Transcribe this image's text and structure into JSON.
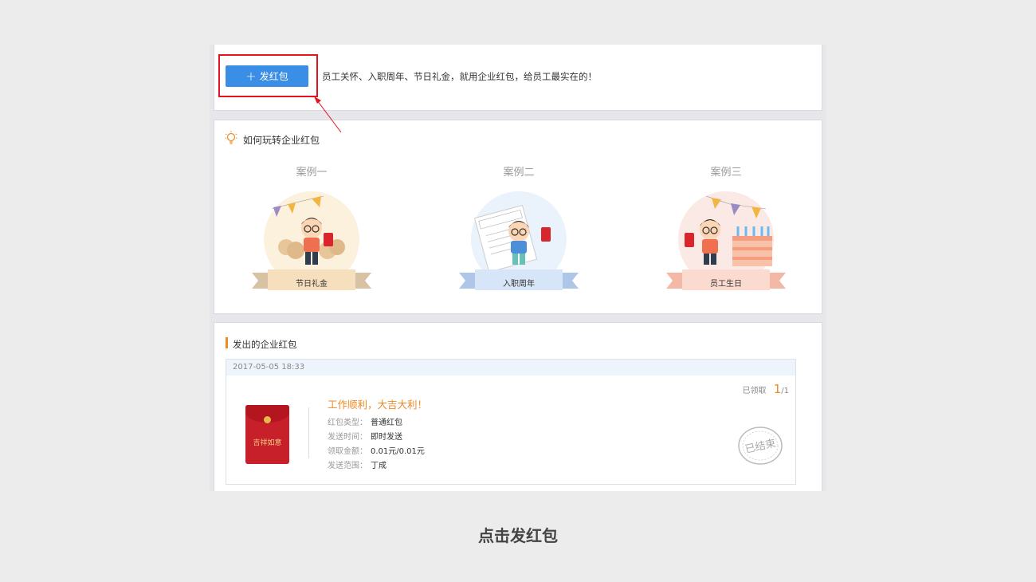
{
  "top": {
    "send_button_label": "发红包",
    "slogan": "员工关怀、入职周年、节日礼金，就用企业红包，给员工最实在的！"
  },
  "how": {
    "title": "如何玩转企业红包",
    "cases": [
      {
        "title": "案例一",
        "label": "节日礼金"
      },
      {
        "title": "案例二",
        "label": "入职周年"
      },
      {
        "title": "案例三",
        "label": "员工生日"
      }
    ]
  },
  "sent": {
    "title": "发出的企业红包",
    "record": {
      "datetime": "2017-05-05 18:33",
      "claimed_label": "已领取",
      "claimed_count": "1",
      "claimed_total": "/1",
      "envelope_text": "吉祥如意",
      "name": "工作顺利，大吉大利！",
      "rows": [
        {
          "label": "红包类型：",
          "value": "普通红包"
        },
        {
          "label": "发送时间：",
          "value": "即时发送"
        },
        {
          "label": "领取金额：",
          "value": "0.01元/0.01元"
        },
        {
          "label": "发送范围：",
          "value": "丁成"
        }
      ],
      "stamp_text": "已结束"
    }
  },
  "caption": "点击发红包",
  "colors": {
    "accent_blue": "#3a8ee6",
    "accent_orange": "#f08a24",
    "highlight_red": "#e3141f"
  }
}
